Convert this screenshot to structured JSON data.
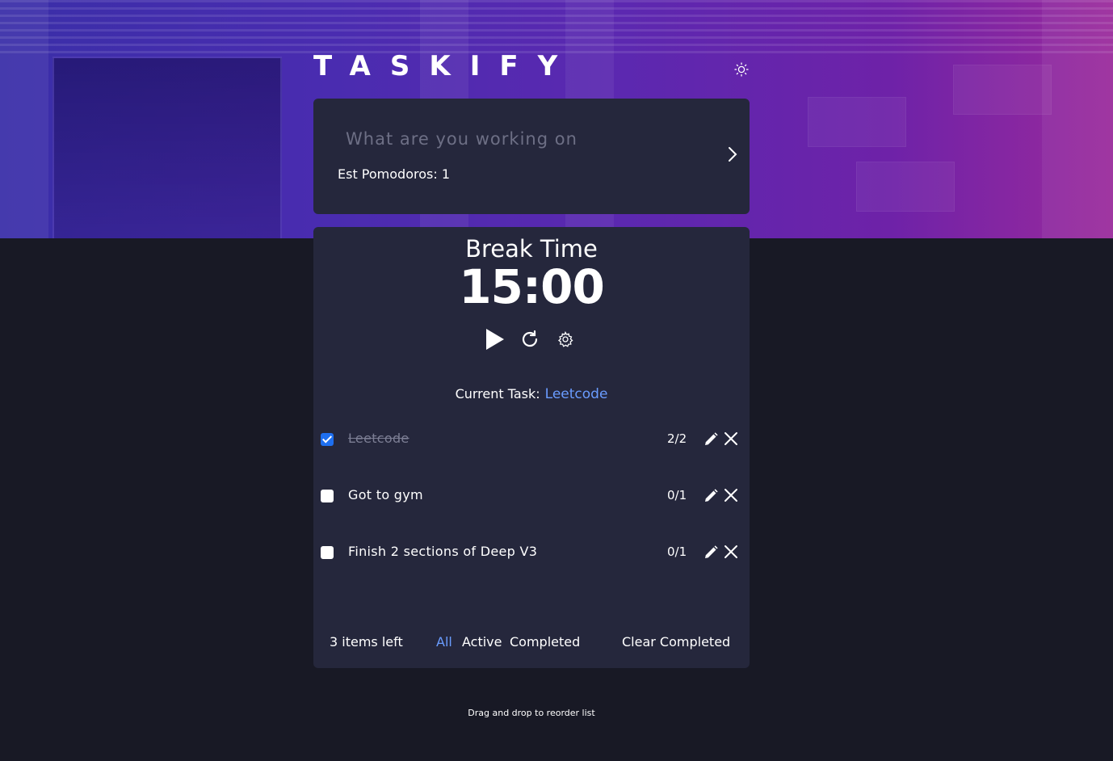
{
  "app": {
    "logo": "TASKIFY",
    "theme_icon": "sun-icon"
  },
  "input": {
    "placeholder": "What are you working on",
    "value": "",
    "est_pomodoros_label": "Est Pomodoros: 1",
    "submit_icon": "chevron-right-icon"
  },
  "timer": {
    "mode": "Break Time",
    "time": "15:00",
    "controls": [
      "play-icon",
      "restart-icon",
      "settings-icon"
    ],
    "current_task_label": "Current Task:",
    "current_task": "Leetcode"
  },
  "todos": [
    {
      "text": "Leetcode",
      "count": "2/2",
      "completed": true
    },
    {
      "text": "Got to gym",
      "count": "0/1",
      "completed": false
    },
    {
      "text": "Finish 2 sections of Deep V3",
      "count": "0/1",
      "completed": false
    }
  ],
  "footer": {
    "items_left": "3 items left",
    "filters": [
      "All",
      "Active",
      "Completed"
    ],
    "active_filter": "All",
    "clear": "Clear Completed"
  },
  "hint": "Drag and drop to reorder list",
  "colors": {
    "accent": "#6a9cff",
    "card": "#25273c",
    "page": "#181925",
    "checkbox_checked": "#1e6ff0"
  }
}
